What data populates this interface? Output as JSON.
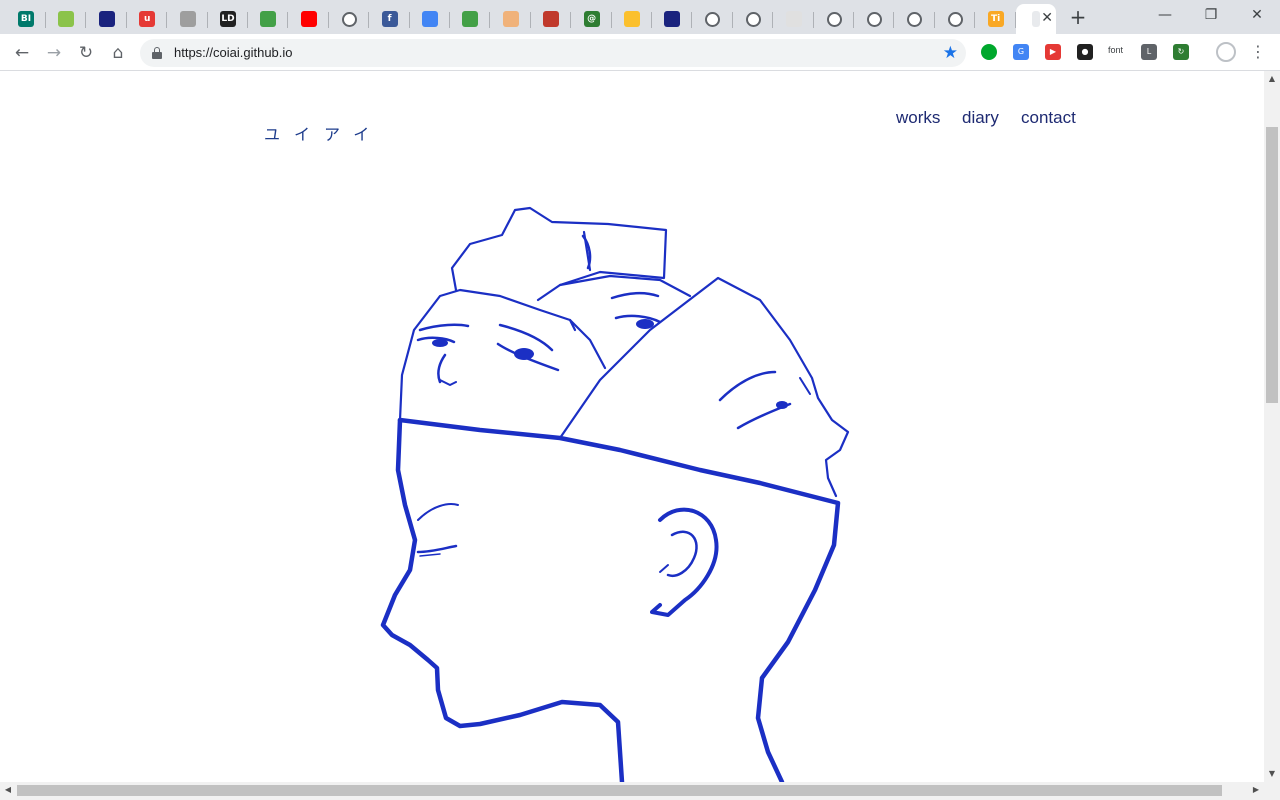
{
  "browser": {
    "tabs": [
      {
        "icon": "bi-icon",
        "label": "BI",
        "color": "#00796b"
      },
      {
        "icon": "anime-icon",
        "label": "",
        "color": "#8bc34a"
      },
      {
        "icon": "tower-icon",
        "label": "",
        "color": "#1a237e"
      },
      {
        "icon": "u-script-icon",
        "label": "u",
        "color": "#e53935"
      },
      {
        "icon": "plane-icon",
        "label": "",
        "color": "#9e9e9e"
      },
      {
        "icon": "ld-icon",
        "label": "LD",
        "color": "#212121"
      },
      {
        "icon": "green-circle-icon",
        "label": "",
        "color": "#43a047"
      },
      {
        "icon": "youtube-icon",
        "label": "",
        "color": "#ff0000"
      },
      {
        "icon": "globe-icon",
        "label": "",
        "color": "#5f6368"
      },
      {
        "icon": "facebook-icon",
        "label": "f",
        "color": "#3b5998"
      },
      {
        "icon": "docs-icon",
        "label": "",
        "color": "#4285f4"
      },
      {
        "icon": "green-circle-icon",
        "label": "",
        "color": "#43a047"
      },
      {
        "icon": "hand-icon",
        "label": "",
        "color": "#f0b27a"
      },
      {
        "icon": "calendar-icon",
        "label": "",
        "color": "#c0392b"
      },
      {
        "icon": "at-icon",
        "label": "@",
        "color": "#2e7d32"
      },
      {
        "icon": "heart-icon",
        "label": "",
        "color": "#fbc02d"
      },
      {
        "icon": "tower-icon",
        "label": "",
        "color": "#1a237e"
      },
      {
        "icon": "globe-icon",
        "label": "",
        "color": "#5f6368"
      },
      {
        "icon": "globe-icon",
        "label": "",
        "color": "#5f6368"
      },
      {
        "icon": "page-icon",
        "label": "",
        "color": "#e0e0e0"
      },
      {
        "icon": "globe-icon",
        "label": "",
        "color": "#5f6368"
      },
      {
        "icon": "globe-icon",
        "label": "",
        "color": "#5f6368"
      },
      {
        "icon": "globe-icon",
        "label": "",
        "color": "#5f6368"
      },
      {
        "icon": "globe-icon",
        "label": "",
        "color": "#5f6368"
      },
      {
        "icon": "ti-icon",
        "label": "Ti",
        "color": "#f9a825"
      }
    ],
    "active_tab": {
      "icon": "tab-icon",
      "label": ""
    },
    "new_tab_label": "+",
    "window_buttons": {
      "minimize": "—",
      "restore": "❐",
      "close": "✕"
    },
    "url": "https://coiai.github.io",
    "bookmark_icon": "star-icon",
    "extensions": [
      {
        "name": "evernote-icon",
        "color": "#00a82d",
        "label": ""
      },
      {
        "name": "translate-icon",
        "color": "#4285f4",
        "label": "G"
      },
      {
        "name": "youtube-ext-icon",
        "color": "#e53935",
        "label": "▶"
      },
      {
        "name": "spy-icon",
        "color": "#212121",
        "label": "●"
      },
      {
        "name": "font-ext",
        "color": "#3c4043",
        "label": "font"
      },
      {
        "name": "line-icon",
        "color": "#5f6368",
        "label": "L"
      },
      {
        "name": "sync-icon",
        "color": "#2e7d32",
        "label": "↻"
      }
    ]
  },
  "site": {
    "logo": "ユイアイ",
    "nav": [
      "works",
      "diary",
      "contact"
    ],
    "line_color": "#1b2fc4"
  }
}
